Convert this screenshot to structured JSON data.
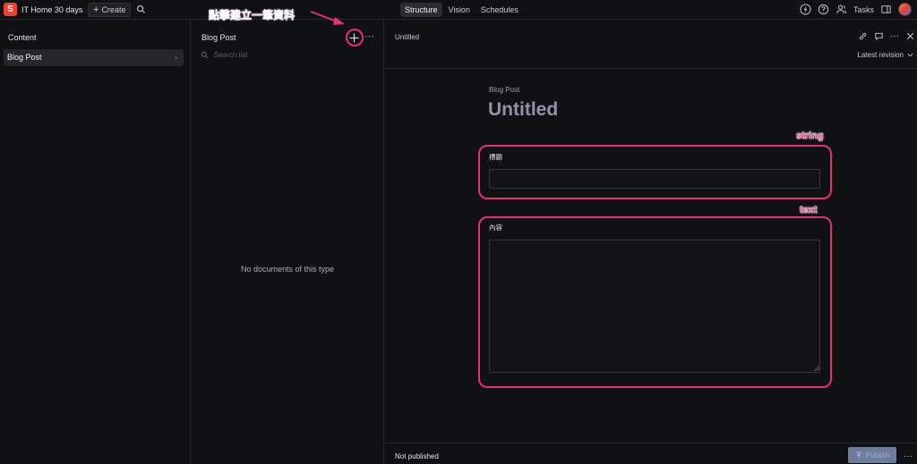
{
  "topbar": {
    "logo": "S",
    "app_title": "IT Home 30 days",
    "create_label": "Create",
    "tabs": [
      {
        "label": "Structure",
        "active": true
      },
      {
        "label": "Vision",
        "active": false
      },
      {
        "label": "Schedules",
        "active": false
      }
    ],
    "tasks_label": "Tasks"
  },
  "content_pane": {
    "title": "Content",
    "items": [
      {
        "label": "Blog Post",
        "selected": true
      }
    ]
  },
  "list_pane": {
    "title": "Blog Post",
    "search_placeholder": "Search list",
    "empty_message": "No documents of this type"
  },
  "document": {
    "header_title": "Untitled",
    "revision_label": "Latest revision",
    "type_label": "Blog Post",
    "title": "Untitled",
    "fields": [
      {
        "label": "標題",
        "value": ""
      },
      {
        "label": "內容",
        "value": ""
      }
    ],
    "status": "Not published",
    "publish_label": "Publish"
  },
  "annotations": {
    "create_hint": "點擊建立一筆資料",
    "string_tag": "string",
    "text_tag": "text",
    "color": "#e8306d"
  },
  "colors": {
    "background": "#101113",
    "brand": "#f03e2f",
    "publish": "#8aa2c8"
  }
}
